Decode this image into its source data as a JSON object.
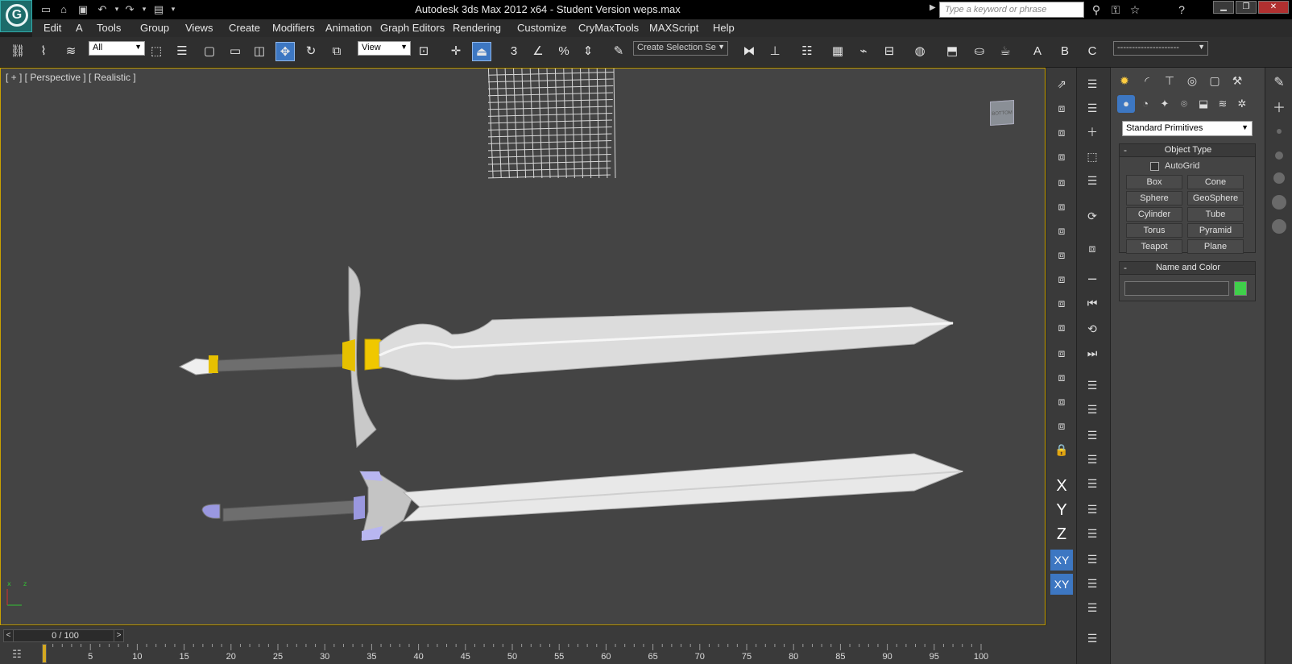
{
  "titlebar": {
    "title": "Autodesk 3ds Max  2012 x64   - Student Version    weps.max",
    "search_placeholder": "Type a keyword or phrase",
    "quick_access": [
      "new-file-icon",
      "open-folder-icon",
      "save-icon",
      "undo-icon",
      "redo-icon",
      "project-folder-icon"
    ],
    "info_center": [
      "binoculars-icon",
      "key-icon",
      "star-icon",
      "help-icon"
    ],
    "window_controls": [
      "minimize",
      "restore",
      "close"
    ]
  },
  "menu": {
    "items": [
      "Edit",
      "A",
      "Tools",
      "Group",
      "Views",
      "Create",
      "Modifiers",
      "Animation",
      "Graph Editors",
      "Rendering",
      "Customize",
      "CryMaxTools",
      "MAXScript",
      "Help"
    ]
  },
  "toolbar": {
    "selection_filter": "All",
    "reference_coord": "View",
    "named_selection_placeholder": "Create Selection Se",
    "right_dropdown": "---------------------",
    "snaps_label": "3",
    "render_tabs": [
      "A",
      "B",
      "C"
    ]
  },
  "viewport": {
    "label": "[ + ] [ Perspective ] [ Realistic ]",
    "viewcube_label": "BOTTOM",
    "tripod_axes": [
      "x",
      "z"
    ],
    "accent_color": "#c8a000",
    "background_color": "#444444"
  },
  "axis_constraints": {
    "x": "X",
    "y": "Y",
    "z": "Z",
    "xy": "XY",
    "xy2": "XY"
  },
  "command_panel": {
    "primitives_dropdown": "Standard Primitives",
    "object_type": {
      "title": "Object Type",
      "autogrid_label": "AutoGrid",
      "autogrid_checked": false,
      "buttons": [
        "Box",
        "Cone",
        "Sphere",
        "GeoSphere",
        "Cylinder",
        "Tube",
        "Torus",
        "Pyramid",
        "Teapot",
        "Plane"
      ]
    },
    "name_and_color": {
      "title": "Name and Color",
      "name_value": "",
      "color": "#3fd04a"
    },
    "tabs": [
      "create-tab",
      "modify-tab",
      "hierarchy-tab",
      "motion-tab",
      "display-tab",
      "utilities-tab"
    ],
    "create_categories": [
      "geometry",
      "shapes",
      "lights",
      "cameras",
      "helpers",
      "space-warps",
      "systems"
    ]
  },
  "timeline": {
    "frame_label": "0 / 100",
    "prev_arrow": "<",
    "next_arrow": ">",
    "ticks": [
      "5",
      "10",
      "15",
      "20",
      "25",
      "30",
      "35",
      "40",
      "45",
      "50",
      "55",
      "60",
      "65",
      "70",
      "75",
      "80",
      "85",
      "90",
      "95",
      "100"
    ],
    "current_frame": 0,
    "total_frames": 100
  }
}
